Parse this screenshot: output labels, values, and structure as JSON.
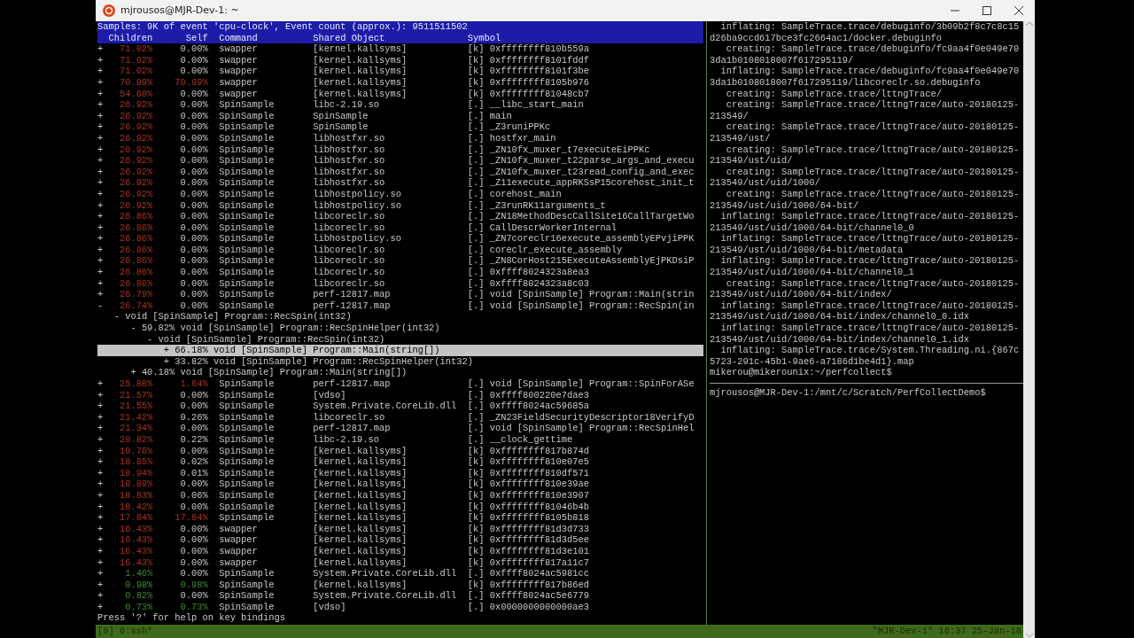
{
  "window": {
    "title": "mjrousos@MJR-Dev-1: ~"
  },
  "perf_report": {
    "summary": "Samples: 9K of event 'cpu-clock', Event count (approx.): 9511511502",
    "columns": [
      "Children",
      "Self",
      "Command",
      "Shared Object",
      "Symbol"
    ],
    "rows": [
      {
        "kind": "entry",
        "sign": "+",
        "children_percent": "71.02%",
        "self_percent": "0.00%",
        "self_colored": false,
        "command": "swapper",
        "shared_object": "[kernel.kallsyms]",
        "symbol_type": "[k]",
        "symbol": "0xffffffff810b559a",
        "color": "#a8321e"
      },
      {
        "kind": "entry",
        "sign": "+",
        "children_percent": "71.02%",
        "self_percent": "0.00%",
        "self_colored": false,
        "command": "swapper",
        "shared_object": "[kernel.kallsyms]",
        "symbol_type": "[k]",
        "symbol": "0xffffffff8101fddf",
        "color": "#a8321e"
      },
      {
        "kind": "entry",
        "sign": "+",
        "children_percent": "71.02%",
        "self_percent": "0.00%",
        "self_colored": false,
        "command": "swapper",
        "shared_object": "[kernel.kallsyms]",
        "symbol_type": "[k]",
        "symbol": "0xffffffff8101f3be",
        "color": "#a8321e"
      },
      {
        "kind": "entry",
        "sign": "+",
        "children_percent": "70.99%",
        "self_percent": "70.99%",
        "self_colored": true,
        "command": "swapper",
        "shared_object": "[kernel.kallsyms]",
        "symbol_type": "[k]",
        "symbol": "0xffffffff8105b976",
        "color": "#a8321e"
      },
      {
        "kind": "entry",
        "sign": "+",
        "children_percent": "54.60%",
        "self_percent": "0.00%",
        "self_colored": false,
        "command": "swapper",
        "shared_object": "[kernel.kallsyms]",
        "symbol_type": "[k]",
        "symbol": "0xffffffff81048cb7",
        "color": "#a8321e"
      },
      {
        "kind": "entry",
        "sign": "+",
        "children_percent": "26.92%",
        "self_percent": "0.00%",
        "self_colored": false,
        "command": "SpinSample",
        "shared_object": "libc-2.19.so",
        "symbol_type": "[.]",
        "symbol": "__libc_start_main",
        "color": "#a8321e"
      },
      {
        "kind": "entry",
        "sign": "+",
        "children_percent": "26.92%",
        "self_percent": "0.00%",
        "self_colored": false,
        "command": "SpinSample",
        "shared_object": "SpinSample",
        "symbol_type": "[.]",
        "symbol": "main",
        "color": "#a8321e"
      },
      {
        "kind": "entry",
        "sign": "+",
        "children_percent": "26.92%",
        "self_percent": "0.00%",
        "self_colored": false,
        "command": "SpinSample",
        "shared_object": "SpinSample",
        "symbol_type": "[.]",
        "symbol": "_Z3runiPPKc",
        "color": "#a8321e"
      },
      {
        "kind": "entry",
        "sign": "+",
        "children_percent": "26.92%",
        "self_percent": "0.00%",
        "self_colored": false,
        "command": "SpinSample",
        "shared_object": "libhostfxr.so",
        "symbol_type": "[.]",
        "symbol": "hostfxr_main",
        "color": "#a8321e"
      },
      {
        "kind": "entry",
        "sign": "+",
        "children_percent": "26.92%",
        "self_percent": "0.00%",
        "self_colored": false,
        "command": "SpinSample",
        "shared_object": "libhostfxr.so",
        "symbol_type": "[.]",
        "symbol": "_ZN10fx_muxer_t7executeEiPPKc",
        "color": "#a8321e"
      },
      {
        "kind": "entry",
        "sign": "+",
        "children_percent": "26.92%",
        "self_percent": "0.00%",
        "self_colored": false,
        "command": "SpinSample",
        "shared_object": "libhostfxr.so",
        "symbol_type": "[.]",
        "symbol": "_ZN10fx_muxer_t22parse_args_and_execu",
        "color": "#a8321e"
      },
      {
        "kind": "entry",
        "sign": "+",
        "children_percent": "26.92%",
        "self_percent": "0.00%",
        "self_colored": false,
        "command": "SpinSample",
        "shared_object": "libhostfxr.so",
        "symbol_type": "[.]",
        "symbol": "_ZN10fx_muxer_t23read_config_and_exec",
        "color": "#a8321e"
      },
      {
        "kind": "entry",
        "sign": "+",
        "children_percent": "26.92%",
        "self_percent": "0.00%",
        "self_colored": false,
        "command": "SpinSample",
        "shared_object": "libhostfxr.so",
        "symbol_type": "[.]",
        "symbol": "_Z11execute_appRKSsP15corehost_init_t",
        "color": "#a8321e"
      },
      {
        "kind": "entry",
        "sign": "+",
        "children_percent": "26.92%",
        "self_percent": "0.00%",
        "self_colored": false,
        "command": "SpinSample",
        "shared_object": "libhostpolicy.so",
        "symbol_type": "[.]",
        "symbol": "corehost_main",
        "color": "#a8321e"
      },
      {
        "kind": "entry",
        "sign": "+",
        "children_percent": "26.92%",
        "self_percent": "0.00%",
        "self_colored": false,
        "command": "SpinSample",
        "shared_object": "libhostpolicy.so",
        "symbol_type": "[.]",
        "symbol": "_Z3runRK11arguments_t",
        "color": "#a8321e"
      },
      {
        "kind": "entry",
        "sign": "+",
        "children_percent": "26.86%",
        "self_percent": "0.00%",
        "self_colored": false,
        "command": "SpinSample",
        "shared_object": "libcoreclr.so",
        "symbol_type": "[.]",
        "symbol": "_ZN18MethodDescCallSite16CallTargetWo",
        "color": "#a8321e"
      },
      {
        "kind": "entry",
        "sign": "+",
        "children_percent": "26.86%",
        "self_percent": "0.00%",
        "self_colored": false,
        "command": "SpinSample",
        "shared_object": "libcoreclr.so",
        "symbol_type": "[.]",
        "symbol": "CallDescrWorkerInternal",
        "color": "#a8321e"
      },
      {
        "kind": "entry",
        "sign": "+",
        "children_percent": "26.86%",
        "self_percent": "0.00%",
        "self_colored": false,
        "command": "SpinSample",
        "shared_object": "libhostpolicy.so",
        "symbol_type": "[.]",
        "symbol": "_ZN7coreclr16execute_assemblyEPvjiPPK",
        "color": "#a8321e"
      },
      {
        "kind": "entry",
        "sign": "+",
        "children_percent": "26.86%",
        "self_percent": "0.00%",
        "self_colored": false,
        "command": "SpinSample",
        "shared_object": "libcoreclr.so",
        "symbol_type": "[.]",
        "symbol": "coreclr_execute_assembly",
        "color": "#a8321e"
      },
      {
        "kind": "entry",
        "sign": "+",
        "children_percent": "26.86%",
        "self_percent": "0.00%",
        "self_colored": false,
        "command": "SpinSample",
        "shared_object": "libcoreclr.so",
        "symbol_type": "[.]",
        "symbol": "_ZN8CorHost215ExecuteAssemblyEjPKDsiP",
        "color": "#a8321e"
      },
      {
        "kind": "entry",
        "sign": "+",
        "children_percent": "26.86%",
        "self_percent": "0.00%",
        "self_colored": false,
        "command": "SpinSample",
        "shared_object": "libcoreclr.so",
        "symbol_type": "[.]",
        "symbol": "0xffff8024323a8ea3",
        "color": "#a8321e"
      },
      {
        "kind": "entry",
        "sign": "+",
        "children_percent": "26.86%",
        "self_percent": "0.00%",
        "self_colored": false,
        "command": "SpinSample",
        "shared_object": "libcoreclr.so",
        "symbol_type": "[.]",
        "symbol": "0xffff8024323a8c03",
        "color": "#a8321e"
      },
      {
        "kind": "entry",
        "sign": "+",
        "children_percent": "26.79%",
        "self_percent": "0.00%",
        "self_colored": false,
        "command": "SpinSample",
        "shared_object": "perf-12817.map",
        "symbol_type": "[.]",
        "symbol": "void [SpinSample] Program::Main(strin",
        "color": "#a8321e"
      },
      {
        "kind": "entry",
        "sign": "-",
        "children_percent": "26.74%",
        "self_percent": "0.00%",
        "self_colored": false,
        "command": "SpinSample",
        "shared_object": "perf-12817.map",
        "symbol_type": "[.]",
        "symbol": "void [SpinSample] Program::RecSpin(in",
        "color": "#a8321e"
      },
      {
        "kind": "callchain",
        "nodes": [
          {
            "sign": "-",
            "text": "void [SpinSample] Program::RecSpin(int32)",
            "selected": false,
            "children": [
              {
                "sign": "-",
                "percent": "59.82%",
                "text": "void [SpinSample] Program::RecSpinHelper(int32)",
                "selected": false,
                "children": [
                  {
                    "sign": "-",
                    "text": "void [SpinSample] Program::RecSpin(int32)",
                    "selected": false,
                    "children": [
                      {
                        "sign": "+",
                        "percent": "66.18%",
                        "text": "void [SpinSample] Program::Main(string[])",
                        "selected": true
                      },
                      {
                        "sign": "+",
                        "percent": "33.82%",
                        "text": "void [SpinSample] Program::RecSpinHelper(int32)",
                        "selected": false
                      }
                    ]
                  }
                ]
              },
              {
                "sign": "+",
                "percent": "40.18%",
                "text": "void [SpinSample] Program::Main(string[])",
                "selected": false
              }
            ]
          }
        ]
      },
      {
        "kind": "entry",
        "sign": "+",
        "children_percent": "25.88%",
        "self_percent": "1.64%",
        "self_colored": true,
        "command": "SpinSample",
        "shared_object": "perf-12817.map",
        "symbol_type": "[.]",
        "symbol": "void [SpinSample] Program::SpinForASe",
        "color": "#a8321e"
      },
      {
        "kind": "entry",
        "sign": "+",
        "children_percent": "21.57%",
        "self_percent": "0.00%",
        "self_colored": false,
        "command": "SpinSample",
        "shared_object": "[vdso]",
        "symbol_type": "[.]",
        "symbol": "0xffff800220e7dae3",
        "color": "#a8321e"
      },
      {
        "kind": "entry",
        "sign": "+",
        "children_percent": "21.55%",
        "self_percent": "0.00%",
        "self_colored": false,
        "command": "SpinSample",
        "shared_object": "System.Private.CoreLib.dll",
        "symbol_type": "[.]",
        "symbol": "0xffff8024ac59685a",
        "color": "#a8321e"
      },
      {
        "kind": "entry",
        "sign": "+",
        "children_percent": "21.42%",
        "self_percent": "0.26%",
        "self_colored": false,
        "command": "SpinSample",
        "shared_object": "libcoreclr.so",
        "symbol_type": "[.]",
        "symbol": "_ZN23FieldSecurityDescriptor18VerifyD",
        "color": "#a8321e"
      },
      {
        "kind": "entry",
        "sign": "+",
        "children_percent": "21.34%",
        "self_percent": "0.00%",
        "self_colored": false,
        "command": "SpinSample",
        "shared_object": "perf-12817.map",
        "symbol_type": "[.]",
        "symbol": "void [SpinSample] Program::RecSpinHel",
        "color": "#a8321e"
      },
      {
        "kind": "entry",
        "sign": "+",
        "children_percent": "20.82%",
        "self_percent": "0.22%",
        "self_colored": false,
        "command": "SpinSample",
        "shared_object": "libc-2.19.so",
        "symbol_type": "[.]",
        "symbol": "__clock_gettime",
        "color": "#a8321e"
      },
      {
        "kind": "entry",
        "sign": "+",
        "children_percent": "19.76%",
        "self_percent": "0.00%",
        "self_colored": false,
        "command": "SpinSample",
        "shared_object": "[kernel.kallsyms]",
        "symbol_type": "[k]",
        "symbol": "0xffffffff817b874d",
        "color": "#a8321e"
      },
      {
        "kind": "entry",
        "sign": "+",
        "children_percent": "18.85%",
        "self_percent": "0.02%",
        "self_colored": false,
        "command": "SpinSample",
        "shared_object": "[kernel.kallsyms]",
        "symbol_type": "[k]",
        "symbol": "0xffffffff810e07e5",
        "color": "#a8321e"
      },
      {
        "kind": "entry",
        "sign": "+",
        "children_percent": "18.94%",
        "self_percent": "0.01%",
        "self_colored": false,
        "command": "SpinSample",
        "shared_object": "[kernel.kallsyms]",
        "symbol_type": "[k]",
        "symbol": "0xffffffff810df571",
        "color": "#a8321e"
      },
      {
        "kind": "entry",
        "sign": "+",
        "children_percent": "18.89%",
        "self_percent": "0.00%",
        "self_colored": false,
        "command": "SpinSample",
        "shared_object": "[kernel.kallsyms]",
        "symbol_type": "[k]",
        "symbol": "0xffffffff810e39ae",
        "color": "#a8321e"
      },
      {
        "kind": "entry",
        "sign": "+",
        "children_percent": "18.83%",
        "self_percent": "0.06%",
        "self_colored": false,
        "command": "SpinSample",
        "shared_object": "[kernel.kallsyms]",
        "symbol_type": "[k]",
        "symbol": "0xffffffff810e3907",
        "color": "#a8321e"
      },
      {
        "kind": "entry",
        "sign": "+",
        "children_percent": "18.42%",
        "self_percent": "0.00%",
        "self_colored": false,
        "command": "SpinSample",
        "shared_object": "[kernel.kallsyms]",
        "symbol_type": "[k]",
        "symbol": "0xffffffff81046b4b",
        "color": "#a8321e"
      },
      {
        "kind": "entry",
        "sign": "+",
        "children_percent": "17.84%",
        "self_percent": "17.84%",
        "self_colored": true,
        "command": "SpinSample",
        "shared_object": "[kernel.kallsyms]",
        "symbol_type": "[k]",
        "symbol": "0xffffffff8105b818",
        "color": "#a8321e"
      },
      {
        "kind": "entry",
        "sign": "+",
        "children_percent": "16.43%",
        "self_percent": "0.00%",
        "self_colored": false,
        "command": "swapper",
        "shared_object": "[kernel.kallsyms]",
        "symbol_type": "[k]",
        "symbol": "0xffffffff81d3d733",
        "color": "#a8321e"
      },
      {
        "kind": "entry",
        "sign": "+",
        "children_percent": "16.43%",
        "self_percent": "0.00%",
        "self_colored": false,
        "command": "swapper",
        "shared_object": "[kernel.kallsyms]",
        "symbol_type": "[k]",
        "symbol": "0xffffffff81d3d5ee",
        "color": "#a8321e"
      },
      {
        "kind": "entry",
        "sign": "+",
        "children_percent": "16.43%",
        "self_percent": "0.00%",
        "self_colored": false,
        "command": "swapper",
        "shared_object": "[kernel.kallsyms]",
        "symbol_type": "[k]",
        "symbol": "0xffffffff81d3e101",
        "color": "#a8321e"
      },
      {
        "kind": "entry",
        "sign": "+",
        "children_percent": "16.43%",
        "self_percent": "0.00%",
        "self_colored": false,
        "command": "swapper",
        "shared_object": "[kernel.kallsyms]",
        "symbol_type": "[k]",
        "symbol": "0xffffffff817a11c7",
        "color": "#a8321e"
      },
      {
        "kind": "entry",
        "sign": "+",
        "children_percent": "1.46%",
        "self_percent": "0.00%",
        "self_colored": false,
        "command": "SpinSample",
        "shared_object": "System.Private.CoreLib.dll",
        "symbol_type": "[.]",
        "symbol": "0xffff8024ac5981cc",
        "color": "#3f8a2c"
      },
      {
        "kind": "entry",
        "sign": "+",
        "children_percent": "0.98%",
        "self_percent": "0.98%",
        "self_colored": true,
        "command": "SpinSample",
        "shared_object": "[kernel.kallsyms]",
        "symbol_type": "[k]",
        "symbol": "0xffffffff817b86ed",
        "color": "#3f8a2c"
      },
      {
        "kind": "entry",
        "sign": "+",
        "children_percent": "0.82%",
        "self_percent": "0.00%",
        "self_colored": false,
        "command": "SpinSample",
        "shared_object": "System.Private.CoreLib.dll",
        "symbol_type": "[.]",
        "symbol": "0xffff8024ac5e6779",
        "color": "#3f8a2c"
      },
      {
        "kind": "entry",
        "sign": "+",
        "children_percent": "0.73%",
        "self_percent": "0.73%",
        "self_colored": true,
        "command": "SpinSample",
        "shared_object": "[vdso]",
        "symbol_type": "[.]",
        "symbol": "0x0000000000000ae3",
        "color": "#3f8a2c"
      }
    ],
    "help_line": "Press '?' for help on key bindings"
  },
  "right_pane": {
    "output_lines": [
      "  inflating: SampleTrace.trace/debuginfo/3b09b2f8c7c8c15",
      "d26ba9ccd617bce3fc2664ac1/docker.debuginfo",
      "   creating: SampleTrace.trace/debuginfo/fc9aa4f0e049e70",
      "3da1b0108018007f617295119/",
      "  inflating: SampleTrace.trace/debuginfo/fc9aa4f0e049e70",
      "3da1b0108018007f617295119/libcoreclr.so.debuginfo",
      "   creating: SampleTrace.trace/lttngTrace/",
      "   creating: SampleTrace.trace/lttngTrace/auto-20180125-",
      "213549/",
      "   creating: SampleTrace.trace/lttngTrace/auto-20180125-",
      "213549/ust/",
      "   creating: SampleTrace.trace/lttngTrace/auto-20180125-",
      "213549/ust/uid/",
      "   creating: SampleTrace.trace/lttngTrace/auto-20180125-",
      "213549/ust/uid/1000/",
      "   creating: SampleTrace.trace/lttngTrace/auto-20180125-",
      "213549/ust/uid/1000/64-bit/",
      "  inflating: SampleTrace.trace/lttngTrace/auto-20180125-",
      "213549/ust/uid/1000/64-bit/channel0_0",
      "  inflating: SampleTrace.trace/lttngTrace/auto-20180125-",
      "213549/ust/uid/1000/64-bit/metadata",
      "  inflating: SampleTrace.trace/lttngTrace/auto-20180125-",
      "213549/ust/uid/1000/64-bit/channel0_1",
      "   creating: SampleTrace.trace/lttngTrace/auto-20180125-",
      "213549/ust/uid/1000/64-bit/index/",
      "  inflating: SampleTrace.trace/lttngTrace/auto-20180125-",
      "213549/ust/uid/1000/64-bit/index/channel0_0.idx",
      "  inflating: SampleTrace.trace/lttngTrace/auto-20180125-",
      "213549/ust/uid/1000/64-bit/index/channel0_1.idx",
      "  inflating: SampleTrace.trace/System.Threading.ni.{867c",
      "5723-291c-45b1-9ae6-a7186d1be4d1}.map",
      "mikerou@mikerounix:~/perfcollect$"
    ],
    "prompt": "mjrousos@MJR-Dev-1:/mnt/c/Scratch/PerfCollectDemo$"
  },
  "status_bar": {
    "left": "[0] 0:ssh*",
    "right": "\"MJR-Dev-1\" 16:37 25-Jan-18"
  }
}
